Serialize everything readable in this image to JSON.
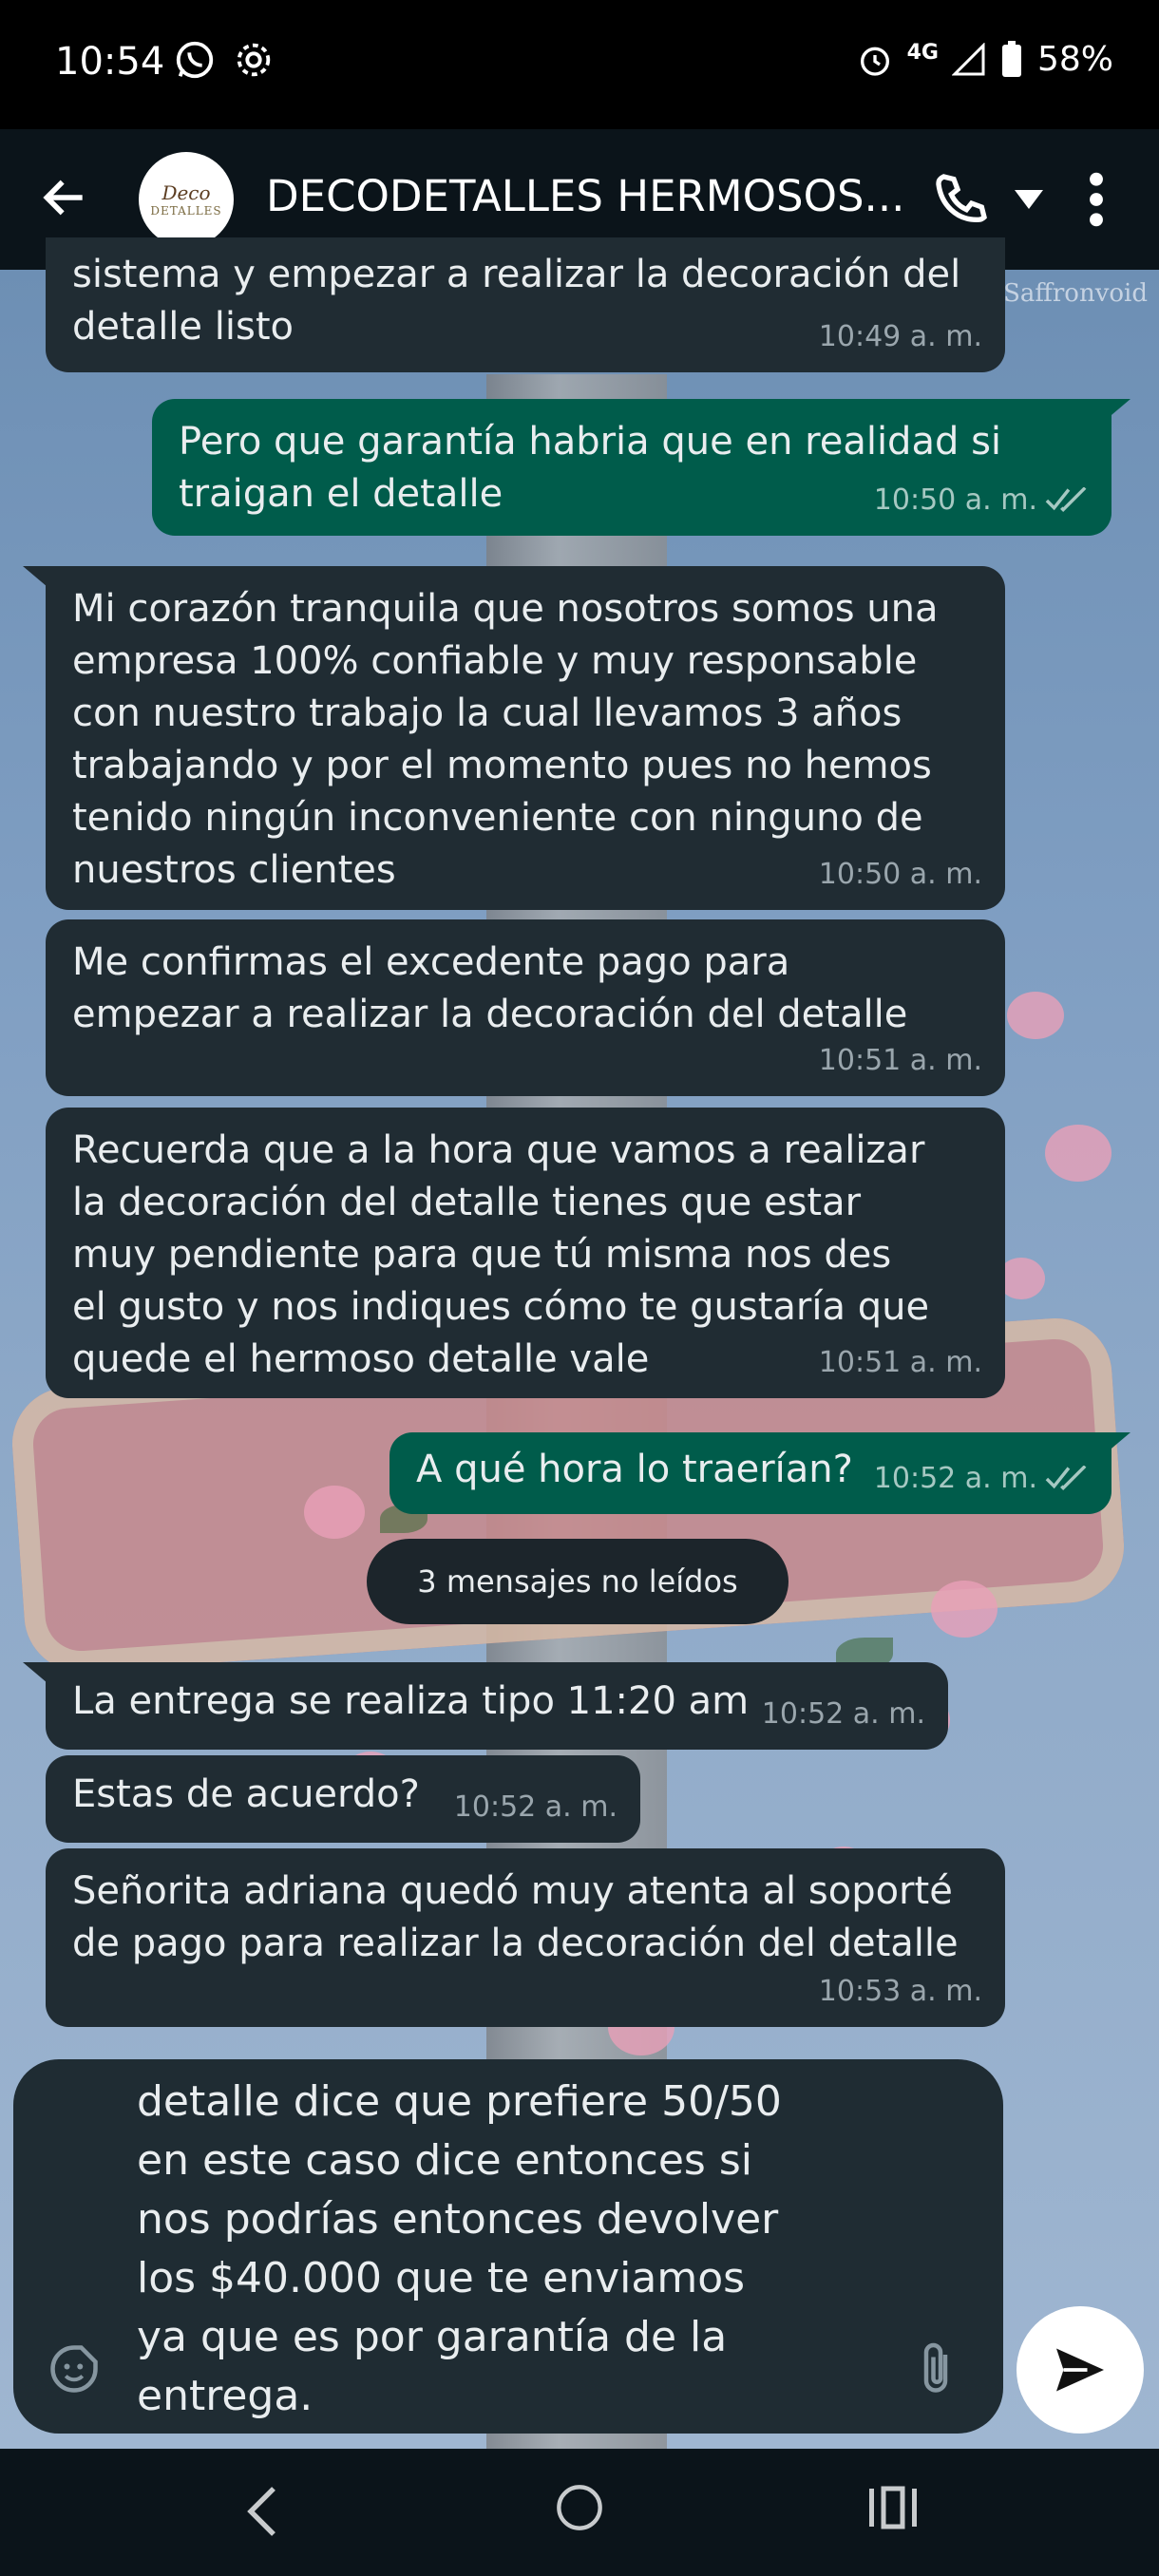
{
  "status_bar": {
    "time": "10:54",
    "network": "4G",
    "battery": "58%"
  },
  "chat_header": {
    "title": "DECODETALLES HERMOSOS...",
    "avatar_text_line1": "Deco",
    "avatar_text_line2": "DETALLES"
  },
  "watermark": "Saffronvoid",
  "messages": [
    {
      "direction": "in",
      "text": "sistema y empezar a realizar la decoración del\ndetalle listo",
      "time": "10:49 a. m."
    },
    {
      "direction": "out",
      "text": "Pero que garantía habria que en realidad si\ntraigan el detalle",
      "time": "10:50 a. m."
    },
    {
      "direction": "in",
      "text": "Mi corazón tranquila que nosotros somos una\nempresa 100% confiable y muy responsable\ncon nuestro trabajo la cual llevamos 3 años\ntrabajando y por el momento pues no hemos\ntenido ningún inconveniente con ninguno de\nnuestros clientes",
      "time": "10:50 a. m."
    },
    {
      "direction": "in",
      "text": "Me confirmas el excedente pago para\nempezar a realizar la decoración del detalle",
      "time": "10:51 a. m."
    },
    {
      "direction": "in",
      "text": "Recuerda que a la hora que vamos a realizar\nla decoración del detalle tienes que estar\nmuy pendiente para que tú misma nos des\nel gusto y nos indiques cómo te gustaría que\nquede el hermoso detalle vale",
      "time": "10:51 a. m."
    },
    {
      "direction": "out",
      "text": "A qué hora lo traerían?",
      "time": "10:52 a. m."
    },
    {
      "direction": "in",
      "text": "La entrega se realiza tipo 11:20 am",
      "time": "10:52 a. m."
    },
    {
      "direction": "in",
      "text": "Estas de acuerdo?",
      "time": "10:52 a. m."
    },
    {
      "direction": "in",
      "text": "Señorita adriana quedó muy atenta al soporté\nde pago para realizar la decoración del detalle",
      "time": "10:53 a. m."
    }
  ],
  "unread_divider": "3 mensajes no leídos",
  "composer": {
    "draft_text": "detalle dice que prefiere 50/50\nen este caso dice entonces si\nnos podrías entonces devolver\nlos $40.000 que te enviamos\nya que es por garantía de la\nentrega."
  },
  "colors": {
    "incoming_bubble": "#202c33",
    "outgoing_bubble": "#005c4b",
    "header_bg": "#0b141a",
    "read_ticks": "#a6c8c2"
  },
  "icons": [
    "whatsapp-icon",
    "settings-icon",
    "alarm-icon",
    "signal-icon",
    "battery-icon",
    "back-arrow-icon",
    "phone-icon",
    "chevron-down-icon",
    "more-vert-icon",
    "double-check-icon",
    "sticker-icon",
    "attach-icon",
    "send-icon",
    "nav-back-icon",
    "nav-home-icon",
    "nav-recents-icon"
  ]
}
